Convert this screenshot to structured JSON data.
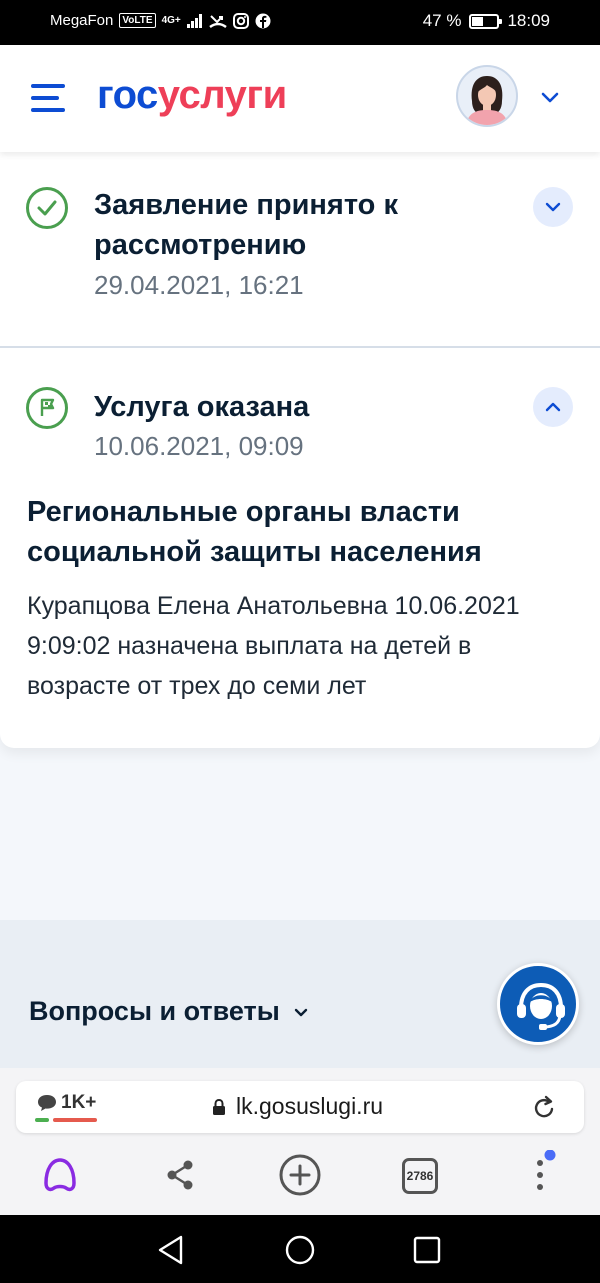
{
  "status_bar": {
    "carrier": "MegaFon",
    "volte": "VoLTE",
    "network": "4G+",
    "battery_percent": "47 %",
    "battery_level": 0.47,
    "time": "18:09"
  },
  "header": {
    "logo_part1": "гос",
    "logo_part2": "услуги"
  },
  "steps": [
    {
      "title": "Заявление принято к рассмотрению",
      "date": "29.04.2021, 16:21",
      "status_icon": "check-circle-icon",
      "expanded": false
    },
    {
      "title": "Услуга оказана",
      "date": "10.06.2021, 09:09",
      "status_icon": "flag-circle-icon",
      "expanded": true
    }
  ],
  "details": {
    "org": "Региональные органы власти социальной защиты населения",
    "text": "Курапцова Елена Анатольевна 10.06.2021 9:09:02 назначена выплата на детей в возрасте от трех до семи лет"
  },
  "faq": {
    "label": "Вопросы и ответы"
  },
  "browser": {
    "comments": "1K+",
    "url": "lk.gosuslugi.ru",
    "tabs_count": "2786"
  },
  "colors": {
    "brand_blue": "#0d4cd3",
    "brand_red": "#ee3f58",
    "success_green": "#4a9f4f",
    "support_blue": "#0d5cb6"
  }
}
